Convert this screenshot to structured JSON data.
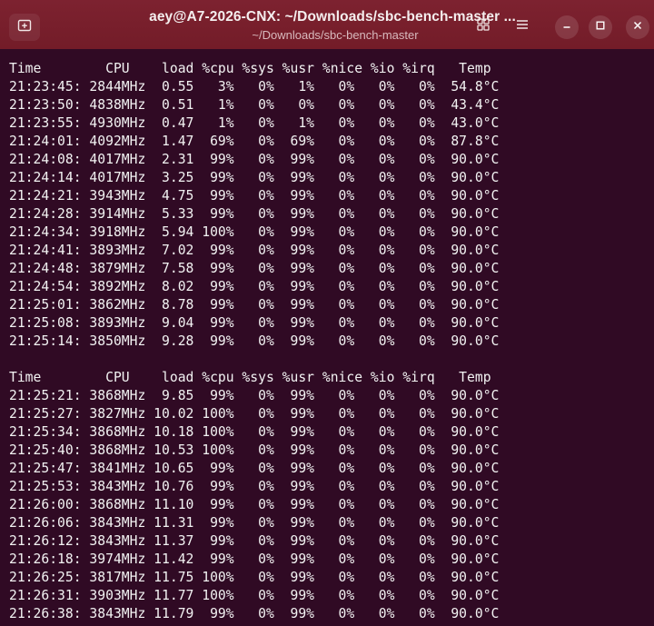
{
  "window": {
    "title": "aey@A7-2026-CNX: ~/Downloads/sbc-bench-master ...",
    "subtitle": "~/Downloads/sbc-bench-master",
    "accent_color": "#7a1f2a",
    "background_color": "#300a24",
    "icons": {
      "new_tab": "new-tab-icon",
      "grid": "grid-icon",
      "menu": "hamburger-menu-icon",
      "minimize": "minimize-icon",
      "maximize": "maximize-icon",
      "close": "close-icon"
    }
  },
  "terminal": {
    "block1": {
      "header": "Time        CPU    load %cpu %sys %usr %nice %io %irq   Temp",
      "rows": [
        "21:23:45: 2844MHz  0.55   3%   0%   1%   0%   0%   0%  54.8°C",
        "21:23:50: 4838MHz  0.51   1%   0%   0%   0%   0%   0%  43.4°C",
        "21:23:55: 4930MHz  0.47   1%   0%   1%   0%   0%   0%  43.0°C",
        "21:24:01: 4092MHz  1.47  69%   0%  69%   0%   0%   0%  87.8°C",
        "21:24:08: 4017MHz  2.31  99%   0%  99%   0%   0%   0%  90.0°C",
        "21:24:14: 4017MHz  3.25  99%   0%  99%   0%   0%   0%  90.0°C",
        "21:24:21: 3943MHz  4.75  99%   0%  99%   0%   0%   0%  90.0°C",
        "21:24:28: 3914MHz  5.33  99%   0%  99%   0%   0%   0%  90.0°C",
        "21:24:34: 3918MHz  5.94 100%   0%  99%   0%   0%   0%  90.0°C",
        "21:24:41: 3893MHz  7.02  99%   0%  99%   0%   0%   0%  90.0°C",
        "21:24:48: 3879MHz  7.58  99%   0%  99%   0%   0%   0%  90.0°C",
        "21:24:54: 3892MHz  8.02  99%   0%  99%   0%   0%   0%  90.0°C",
        "21:25:01: 3862MHz  8.78  99%   0%  99%   0%   0%   0%  90.0°C",
        "21:25:08: 3893MHz  9.04  99%   0%  99%   0%   0%   0%  90.0°C",
        "21:25:14: 3850MHz  9.28  99%   0%  99%   0%   0%   0%  90.0°C"
      ]
    },
    "block2": {
      "header": "Time        CPU    load %cpu %sys %usr %nice %io %irq   Temp",
      "rows": [
        "21:25:21: 3868MHz  9.85  99%   0%  99%   0%   0%   0%  90.0°C",
        "21:25:27: 3827MHz 10.02 100%   0%  99%   0%   0%   0%  90.0°C",
        "21:25:34: 3868MHz 10.18 100%   0%  99%   0%   0%   0%  90.0°C",
        "21:25:40: 3868MHz 10.53 100%   0%  99%   0%   0%   0%  90.0°C",
        "21:25:47: 3841MHz 10.65  99%   0%  99%   0%   0%   0%  90.0°C",
        "21:25:53: 3843MHz 10.76  99%   0%  99%   0%   0%   0%  90.0°C",
        "21:26:00: 3868MHz 11.10  99%   0%  99%   0%   0%   0%  90.0°C",
        "21:26:06: 3843MHz 11.31  99%   0%  99%   0%   0%   0%  90.0°C",
        "21:26:12: 3843MHz 11.37  99%   0%  99%   0%   0%   0%  90.0°C",
        "21:26:18: 3974MHz 11.42  99%   0%  99%   0%   0%   0%  90.0°C",
        "21:26:25: 3817MHz 11.75 100%   0%  99%   0%   0%   0%  90.0°C",
        "21:26:31: 3903MHz 11.77 100%   0%  99%   0%   0%   0%  90.0°C",
        "21:26:38: 3843MHz 11.79  99%   0%  99%   0%   0%   0%  90.0°C"
      ]
    }
  }
}
